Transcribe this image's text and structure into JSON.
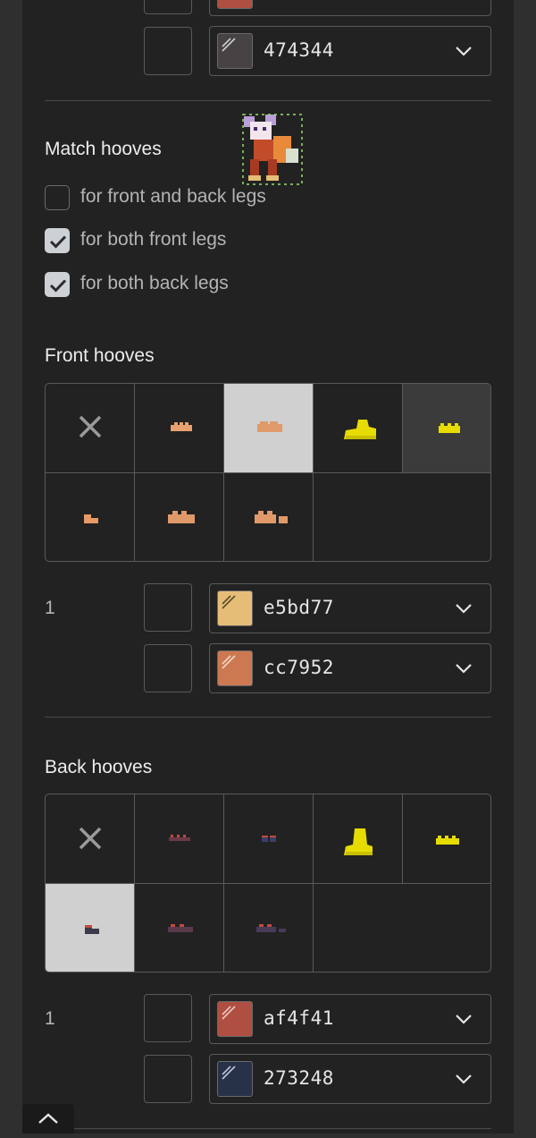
{
  "top_colors": [
    {
      "hex": "",
      "swatch": "#af4f41"
    },
    {
      "hex": "474344",
      "swatch": "#474344"
    }
  ],
  "match_hooves": {
    "title": "Match hooves",
    "options": [
      {
        "label": "for front and back legs",
        "checked": false
      },
      {
        "label": "for both front legs",
        "checked": true
      },
      {
        "label": "for both back legs",
        "checked": true
      }
    ]
  },
  "front_hooves": {
    "title": "Front hooves",
    "row_number": "1",
    "colors": [
      {
        "hex": "e5bd77",
        "swatch": "#e5bd77"
      },
      {
        "hex": "cc7952",
        "swatch": "#cc7952"
      }
    ]
  },
  "back_hooves": {
    "title": "Back hooves",
    "row_number": "1",
    "colors": [
      {
        "hex": "af4f41",
        "swatch": "#af4f41"
      },
      {
        "hex": "273248",
        "swatch": "#273248"
      }
    ]
  },
  "icons": {
    "none": "close-x-icon",
    "dropdown": "chevron-down-icon",
    "scroll_top": "chevron-up-icon"
  }
}
